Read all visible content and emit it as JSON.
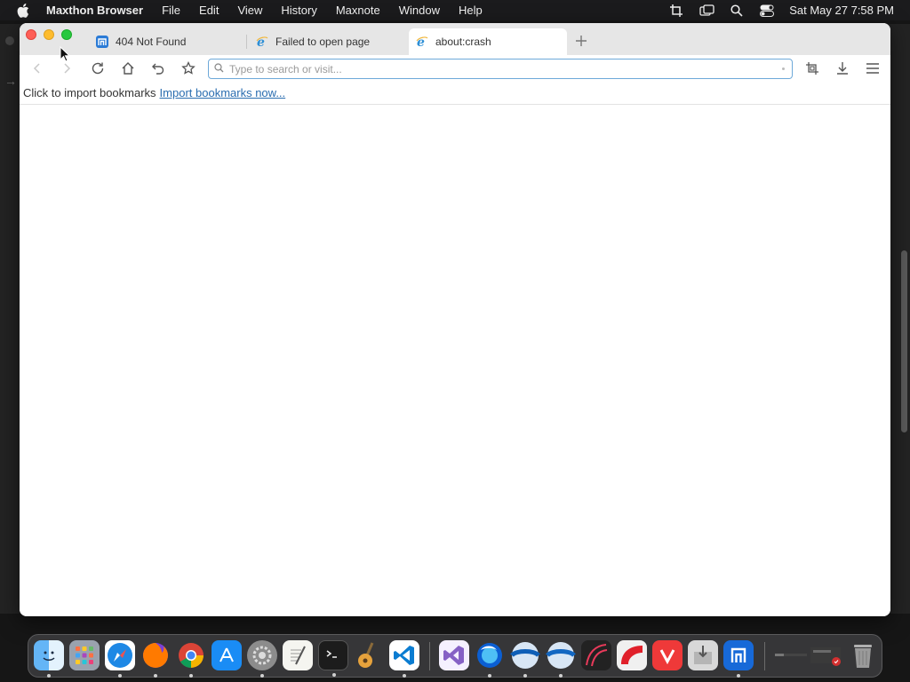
{
  "menubar": {
    "app_name": "Maxthon Browser",
    "items": [
      "File",
      "Edit",
      "View",
      "History",
      "Maxnote",
      "Window",
      "Help"
    ],
    "clock": "Sat May 27  7:58 PM"
  },
  "tabs": [
    {
      "title": "404 Not Found",
      "icon": "maxthon-icon"
    },
    {
      "title": "Failed to open page",
      "icon": "ie-icon"
    },
    {
      "title": "about:crash",
      "icon": "ie-icon"
    }
  ],
  "active_tab": 2,
  "address": {
    "value": "",
    "placeholder": "Type to search or visit..."
  },
  "bookmarks": {
    "prompt": "Click to import bookmarks",
    "link": "Import bookmarks now..."
  },
  "dock": [
    "Finder",
    "Launchpad",
    "Safari",
    "Firefox",
    "Chrome",
    "App Store",
    "System Preferences",
    "TextEdit",
    "Terminal",
    "GarageBand",
    "VS Code",
    "Visual Studio",
    "Firefox Developer",
    "Browser A",
    "Browser B",
    "Browser C",
    "Browser D",
    "Vivaldi",
    "Installer",
    "Maxthon",
    "Downloads",
    "Trash"
  ],
  "colors": {
    "accent": "#2a6db0",
    "address_border": "#6ea9d9",
    "close": "#fe5f57",
    "minimize": "#febc2e",
    "maximize": "#28c840"
  }
}
